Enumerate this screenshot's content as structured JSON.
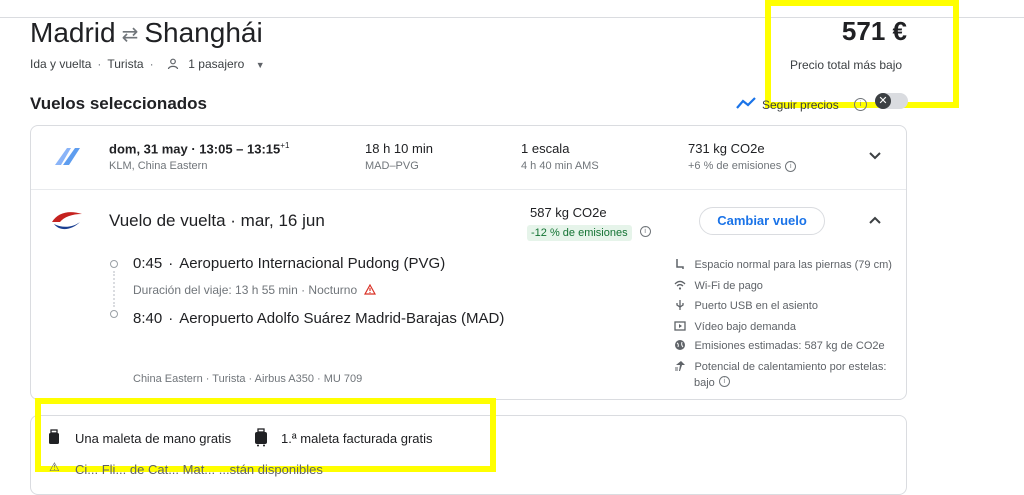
{
  "header": {
    "origin": "Madrid",
    "destination": "Shanghái",
    "trip_type": "Ida y vuelta",
    "cabin": "Turista",
    "passengers": "1 pasajero",
    "price": "571 €",
    "price_label": "Precio total más bajo"
  },
  "selected": {
    "title": "Vuelos seleccionados",
    "track_label": "Seguir precios"
  },
  "outbound": {
    "date_time": "dom, 31 may · 13:05 – 13:15",
    "plus_day": "+1",
    "airlines": "KLM, China Eastern",
    "duration": "18 h 10 min",
    "route": "MAD–PVG",
    "stops": "1 escala",
    "layover": "4 h 40 min AMS",
    "emissions": "731 kg CO2e",
    "emissions_delta": "+6 % de emisiones"
  },
  "return": {
    "title": "Vuelo de vuelta · mar, 16 jun",
    "emissions": "587 kg CO2e",
    "emissions_delta": "-12 % de emisiones",
    "change_button": "Cambiar vuelo",
    "dep_time": "0:45",
    "dep_airport": "Aeropuerto Internacional Pudong (PVG)",
    "travel_duration": "Duración del viaje: 13 h 55 min · Nocturno",
    "arr_time": "8:40",
    "arr_airport": "Aeropuerto Adolfo Suárez Madrid-Barajas (MAD)",
    "flight_info": "China Eastern · Turista · Airbus A350 · MU 709"
  },
  "amenities": [
    {
      "icon": "seat-icon",
      "label": "Espacio normal para las piernas (79 cm)"
    },
    {
      "icon": "wifi-icon",
      "label": "Wi-Fi de pago"
    },
    {
      "icon": "usb-icon",
      "label": "Puerto USB en el asiento"
    },
    {
      "icon": "video-icon",
      "label": "Vídeo bajo demanda"
    },
    {
      "icon": "globe-icon",
      "label": "Emisiones estimadas: 587 kg de CO2e"
    },
    {
      "icon": "contrail-icon",
      "label": "Potencial de calentamiento por estelas:"
    },
    {
      "icon": "contrail-icon",
      "label": "bajo"
    }
  ],
  "baggage": {
    "carry_on": "Una maleta de mano gratis",
    "checked": "1.ª maleta facturada gratis",
    "partial_note": "Ci... Fli... de Cat... Mat... ...stán disponibles"
  },
  "colors": {
    "accent": "#1a73e8",
    "highlight": "#ffff00",
    "green": "#137333"
  }
}
